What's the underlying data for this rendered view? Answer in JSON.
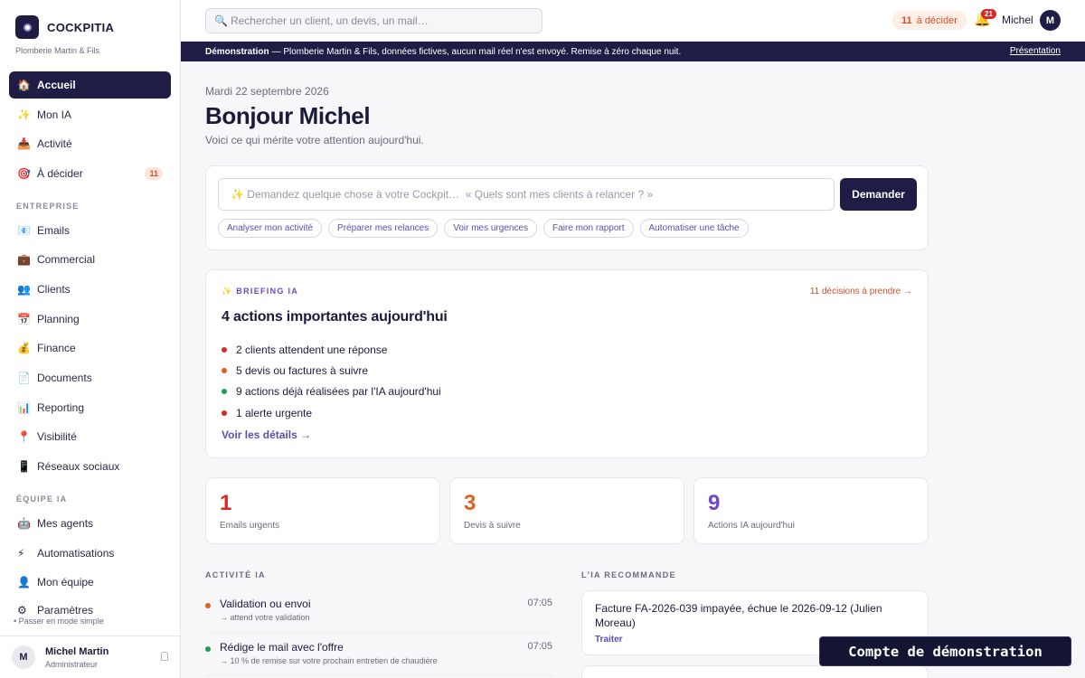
{
  "brand": {
    "name": "COCKPITIA",
    "subtitle": "Plomberie Martin & Fils"
  },
  "sidebar": {
    "items": [
      {
        "icon": "🏠",
        "label": "Accueil",
        "active": true
      },
      {
        "icon": "✨",
        "label": "Mon IA"
      },
      {
        "icon": "📥",
        "label": "Activité"
      },
      {
        "icon": "🎯",
        "label": "À décider",
        "badge": "11"
      }
    ],
    "section_enterprise": "ENTREPRISE",
    "enterprise_items": [
      {
        "icon": "📧",
        "label": "Emails"
      },
      {
        "icon": "💼",
        "label": "Commercial"
      },
      {
        "icon": "👥",
        "label": "Clients"
      },
      {
        "icon": "📅",
        "label": "Planning"
      },
      {
        "icon": "💰",
        "label": "Finance"
      },
      {
        "icon": "📄",
        "label": "Documents"
      },
      {
        "icon": "📊",
        "label": "Reporting"
      },
      {
        "icon": "📍",
        "label": "Visibilité"
      },
      {
        "icon": "📱",
        "label": "Réseaux sociaux"
      }
    ],
    "section_team": "ÉQUIPE IA",
    "team_items": [
      {
        "icon": "🤖",
        "label": "Mes agents"
      },
      {
        "icon": "⚡",
        "label": "Automatisations"
      },
      {
        "icon": "👤",
        "label": "Mon équipe"
      },
      {
        "icon": "⚙",
        "label": "Paramètres"
      }
    ],
    "simple_mode": "• Passer en mode simple",
    "user": {
      "initial": "M",
      "name": "Michel Martin",
      "role": "Administrateur"
    }
  },
  "header": {
    "search_placeholder": "Rechercher un client, un devis, un mail…",
    "decide_count": "11",
    "decide_label": "à décider",
    "notif_count": "21",
    "user_name": "Michel",
    "user_initial": "M"
  },
  "banner": {
    "strong": "Démonstration",
    "text": "— Plomberie Martin & Fils, données fictives, aucun mail réel n'est envoyé. Remise à zéro chaque nuit.",
    "link": "Présentation"
  },
  "main": {
    "date": "Mardi 22 septembre 2026",
    "greeting": "Bonjour Michel",
    "subtitle": "Voici ce qui mérite votre attention aujourd'hui.",
    "ask": {
      "placeholder": "✨ Demandez quelque chose à votre Cockpit…  « Quels sont mes clients à relancer ? »",
      "button": "Demander",
      "chips": [
        "Analyser mon activité",
        "Préparer mes relances",
        "Voir mes urgences",
        "Faire mon rapport",
        "Automatiser une tâche"
      ]
    },
    "briefing": {
      "tag": "✨  BRIEFING IA",
      "link": "11 décisions à prendre →",
      "title": "4 actions importantes aujourd'hui",
      "items": [
        {
          "text": "2 clients attendent une réponse",
          "color": "#d42a2a"
        },
        {
          "text": "5 devis ou factures à suivre",
          "color": "#e0601f"
        },
        {
          "text": "9 actions déjà réalisées par l'IA aujourd'hui",
          "color": "#1f9d55"
        },
        {
          "text": "1 alerte urgente",
          "color": "#d42a2a"
        }
      ],
      "more": "Voir les détails →"
    },
    "stats": [
      {
        "value": "1",
        "label": "Emails urgents",
        "color": "#d42a2a"
      },
      {
        "value": "3",
        "label": "Devis à suivre",
        "color": "#e0601f"
      },
      {
        "value": "9",
        "label": "Actions IA aujourd'hui",
        "color": "#6b46c9"
      }
    ],
    "activity_title": "ACTIVITÉ IA",
    "activity": [
      {
        "title": "Validation ou envoi",
        "sub": "→ attend votre validation",
        "time": "07:05",
        "color": "#e0601f"
      },
      {
        "title": "Rédige le mail avec l'offre",
        "sub": "→ 10 % de remise sur votre prochain entretien de chaudière",
        "time": "07:05",
        "color": "#1f9d55"
      }
    ],
    "reco_title": "L'IA RECOMMANDE",
    "reco": {
      "text": "Facture FA-2026-039 impayée, échue le 2026-09-12 (Julien Moreau)",
      "action": "Traiter"
    }
  },
  "demo_badge": "Compte de démonstration"
}
